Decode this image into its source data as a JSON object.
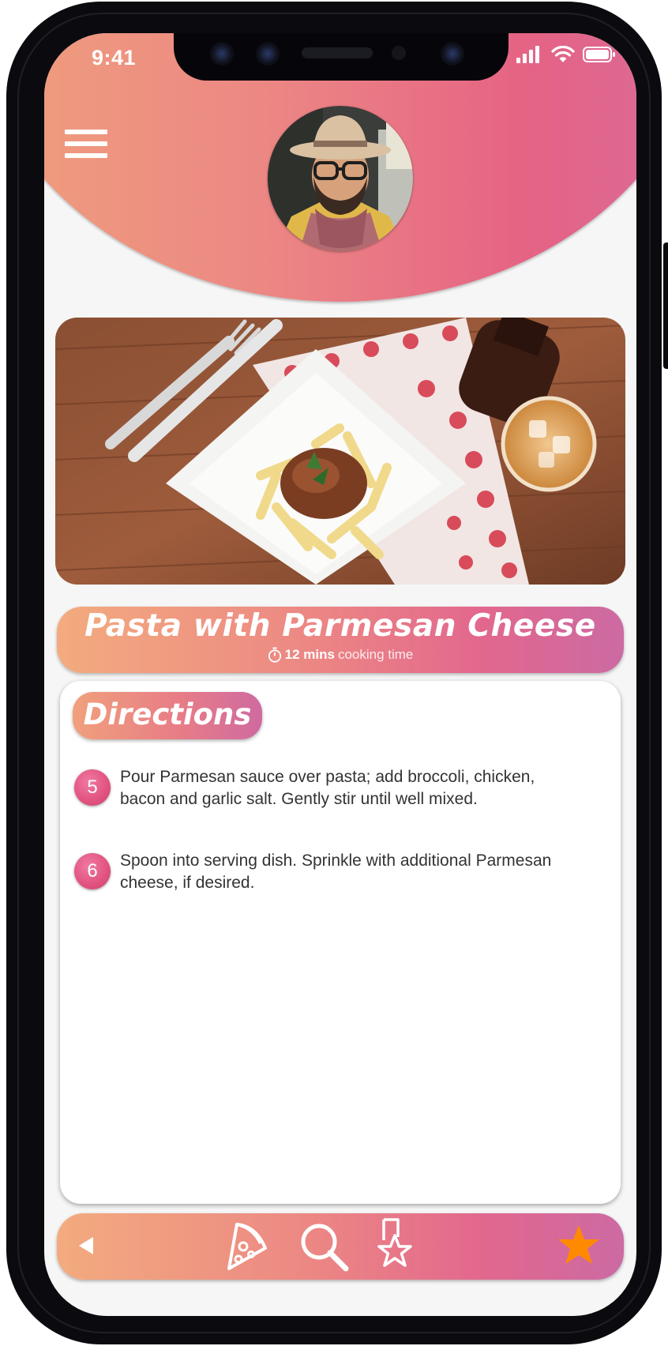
{
  "status_bar": {
    "time": "9:41"
  },
  "recipe": {
    "title": "Pasta with Parmesan Cheese",
    "cook_time_value": "12 mins",
    "cook_time_label": "cooking time"
  },
  "directions": {
    "heading": "Directions",
    "steps": [
      {
        "number": "5",
        "text": "Pour Parmesan sauce over pasta; add broccoli, chicken, bacon and garlic salt. Gently stir until well mixed."
      },
      {
        "number": "6",
        "text": "Spoon into serving dish. Sprinkle with additional Parmesan cheese, if desired."
      }
    ]
  },
  "bottom_nav": {
    "items": [
      "back-icon",
      "pizza-icon",
      "search-icon",
      "bookmark-star-icon",
      "favorite-star-icon"
    ],
    "accent_color": "#ff8a00"
  },
  "colors": {
    "gradient_start": "#f0a07c",
    "gradient_mid": "#e56384",
    "gradient_end": "#d96b9a",
    "step_badge": "#e1527f"
  }
}
